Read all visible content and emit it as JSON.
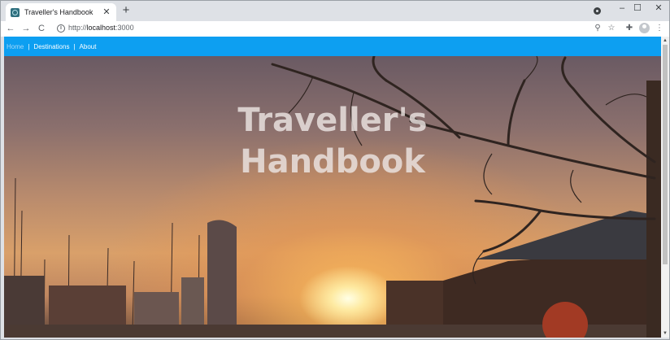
{
  "browser": {
    "tab_title": "Traveller's Handbook",
    "tab_close": "✕",
    "new_tab": "+",
    "url_prefix": "http://",
    "url_host": "localhost",
    "url_port": ":3000",
    "window_controls": {
      "minimize": "–",
      "maximize": "☐",
      "close": "✕"
    },
    "nav": {
      "back": "←",
      "forward": "→",
      "reload": "C"
    }
  },
  "site": {
    "nav": {
      "items": [
        {
          "label": "Home"
        },
        {
          "label": "Destinations"
        },
        {
          "label": "About"
        }
      ],
      "separator": "|"
    },
    "hero": {
      "title_line1": "Traveller's",
      "title_line2": "Handbook"
    }
  },
  "colors": {
    "nav_bg": "#0d9ff1",
    "nav_active": "#a6d7f8"
  },
  "icons": [
    "info-icon",
    "zoom-icon",
    "star-icon",
    "extensions-icon",
    "profile-icon",
    "menu-icon"
  ]
}
